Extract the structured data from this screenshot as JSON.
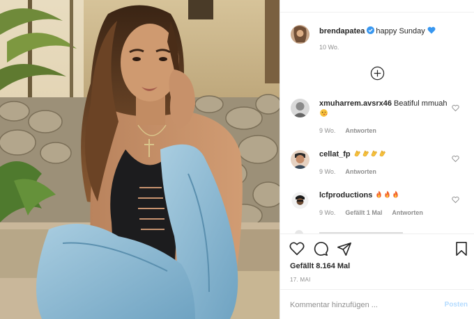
{
  "caption": {
    "username": "brendapatea",
    "text": "happy Sunday",
    "time": "10 Wo."
  },
  "comments": [
    {
      "username": "xmuharrem.avsrx46",
      "text": "Beatiful mmuah",
      "time": "9 Wo.",
      "likes": "",
      "reply": "Antworten",
      "emoji": "kissing-face"
    },
    {
      "username": "cellat_fp",
      "text": "",
      "time": "9 Wo.",
      "likes": "",
      "reply": "Antworten",
      "emoji": "clapping-hands x4"
    },
    {
      "username": "lcfproductions",
      "text": "",
      "time": "9 Wo.",
      "likes": "Gefällt 1 Mal",
      "reply": "Antworten",
      "emoji": "fire x3"
    }
  ],
  "likes_text": "Gefällt 8.164 Mal",
  "post_date": "17. MAI",
  "comment_input": {
    "placeholder": "Kommentar hinzufügen ...",
    "value": ""
  },
  "post_button_label": "Posten",
  "icons": [
    "heart-icon",
    "comment-icon",
    "share-icon",
    "bookmark-icon",
    "plus-circle-icon",
    "verified-badge-icon"
  ],
  "colors": {
    "verified": "#3897f0",
    "blue_heart": "#3897f0",
    "post_button_disabled": "#b3dbff",
    "meta": "#8e8e8e"
  }
}
